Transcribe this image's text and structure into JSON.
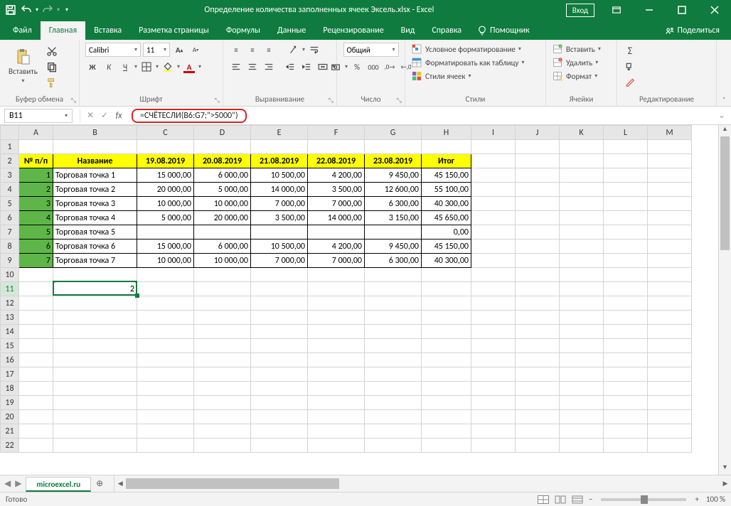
{
  "title": "Определение количества заполненных ячеек Эксель.xlsx  -  Excel",
  "signin": "Вход",
  "tabs": {
    "file": "Файл",
    "home": "Главная",
    "insert": "Вставка",
    "layout": "Разметка страницы",
    "formulas": "Формулы",
    "data": "Данные",
    "review": "Рецензирование",
    "view": "Вид",
    "help": "Справка",
    "tellme": "Помощник",
    "share": "Поделиться"
  },
  "ribbon": {
    "paste": "Вставить",
    "clipboard": "Буфер обмена",
    "font_name": "Calibri",
    "font_size": "11",
    "font_group": "Шрифт",
    "align_group": "Выравнивание",
    "number_format": "Общий",
    "number_group": "Число",
    "cond_fmt": "Условное форматирование",
    "as_table": "Форматировать как таблицу",
    "cell_styles": "Стили ячеек",
    "styles_group": "Стили",
    "insert_cells": "Вставить",
    "delete_cells": "Удалить",
    "format_cells": "Формат",
    "cells_group": "Ячейки",
    "editing_group": "Редактирование",
    "bold": "Ж",
    "italic": "К",
    "underline": "Ч"
  },
  "namebox": "B11",
  "formula": "=СЧЁТЕСЛИ(B6:G7;\">5000\")",
  "columns": [
    "A",
    "B",
    "C",
    "D",
    "E",
    "F",
    "G",
    "H",
    "I",
    "J",
    "K",
    "L",
    "M"
  ],
  "headers": {
    "num": "№ п/п",
    "name": "Название",
    "d1": "19.08.2019",
    "d2": "20.08.2019",
    "d3": "21.08.2019",
    "d4": "22.08.2019",
    "d5": "23.08.2019",
    "total": "Итог"
  },
  "rows": [
    {
      "n": "1",
      "name": "Торговая точка 1",
      "d1": "15 000,00",
      "d2": "6 000,00",
      "d3": "10 500,00",
      "d4": "4 200,00",
      "d5": "9 450,00",
      "t": "45 150,00"
    },
    {
      "n": "2",
      "name": "Торговая точка 2",
      "d1": "20 000,00",
      "d2": "5 000,00",
      "d3": "14 000,00",
      "d4": "3 500,00",
      "d5": "12 600,00",
      "t": "55 100,00"
    },
    {
      "n": "3",
      "name": "Торговая точка 3",
      "d1": "10 000,00",
      "d2": "10 000,00",
      "d3": "7 000,00",
      "d4": "7 000,00",
      "d5": "6 300,00",
      "t": "40 300,00"
    },
    {
      "n": "4",
      "name": "Торговая точка 4",
      "d1": "5 000,00",
      "d2": "20 000,00",
      "d3": "3 500,00",
      "d4": "14 000,00",
      "d5": "3 150,00",
      "t": "45 650,00"
    },
    {
      "n": "5",
      "name": "Торговая точка 5",
      "d1": "",
      "d2": "",
      "d3": "",
      "d4": "",
      "d5": "",
      "t": "0,00"
    },
    {
      "n": "6",
      "name": "Торговая точка 6",
      "d1": "15 000,00",
      "d2": "6 000,00",
      "d3": "10 500,00",
      "d4": "4 200,00",
      "d5": "9 450,00",
      "t": "45 150,00"
    },
    {
      "n": "7",
      "name": "Торговая точка 7",
      "d1": "10 000,00",
      "d2": "10 000,00",
      "d3": "7 000,00",
      "d4": "7 000,00",
      "d5": "6 300,00",
      "t": "40 300,00"
    }
  ],
  "result_value": "2",
  "sheet": "microexcel.ru",
  "status_ready": "Готово",
  "zoom_minus": "−",
  "zoom_plus": "+",
  "zoom_pct": "100 %"
}
